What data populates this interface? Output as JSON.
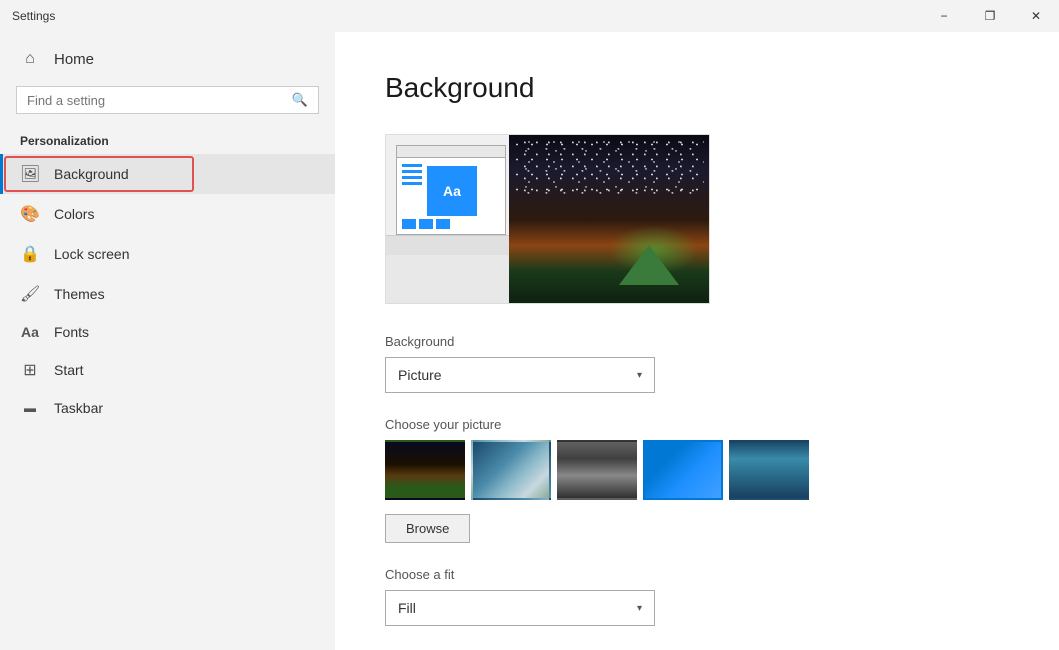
{
  "titlebar": {
    "title": "Settings",
    "minimize_label": "−",
    "maximize_label": "❐",
    "close_label": "✕"
  },
  "sidebar": {
    "home_label": "Home",
    "search_placeholder": "Find a setting",
    "section_title": "Personalization",
    "items": [
      {
        "id": "background",
        "label": "Background",
        "icon": "🖼",
        "active": true
      },
      {
        "id": "colors",
        "label": "Colors",
        "icon": "🎨",
        "active": false
      },
      {
        "id": "lock-screen",
        "label": "Lock screen",
        "icon": "🔒",
        "active": false
      },
      {
        "id": "themes",
        "label": "Themes",
        "icon": "🖌",
        "active": false
      },
      {
        "id": "fonts",
        "label": "Fonts",
        "icon": "A",
        "active": false
      },
      {
        "id": "start",
        "label": "Start",
        "icon": "⊞",
        "active": false
      },
      {
        "id": "taskbar",
        "label": "Taskbar",
        "icon": "▬",
        "active": false
      }
    ]
  },
  "main": {
    "page_title": "Background",
    "background_label": "Background",
    "dropdown_value": "Picture",
    "choose_picture_label": "Choose your picture",
    "browse_label": "Browse",
    "choose_fit_label": "Choose a fit",
    "fit_value": "Fill"
  }
}
